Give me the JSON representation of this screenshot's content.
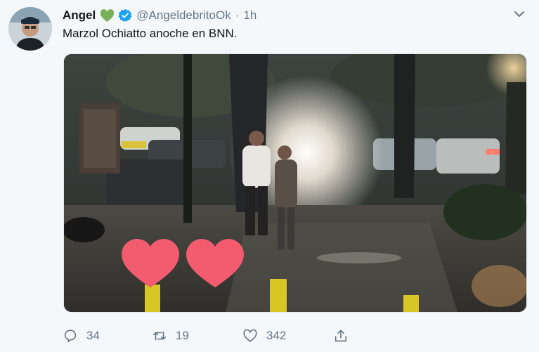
{
  "tweet": {
    "author": {
      "display_name": "Angel",
      "handle": "@AngeldebritoOk",
      "avatar_icon": "avatar-icon"
    },
    "separator": "·",
    "time": "1h",
    "text": "Marzol Ochiatto anoche en BNN.",
    "media_alt_icon": "photo-icon"
  },
  "actions": {
    "reply": {
      "icon": "reply-icon",
      "count": "34"
    },
    "retweet": {
      "icon": "retweet-icon",
      "count": "19"
    },
    "like": {
      "icon": "like-icon",
      "count": "342"
    },
    "share": {
      "icon": "share-icon"
    }
  },
  "colors": {
    "background": "#f5f8fa",
    "text_primary": "#14171a",
    "text_secondary": "#657786",
    "verified_blue": "#1da1f2",
    "green_heart": "#78b159",
    "overlay_heart": "#f35b6f"
  }
}
